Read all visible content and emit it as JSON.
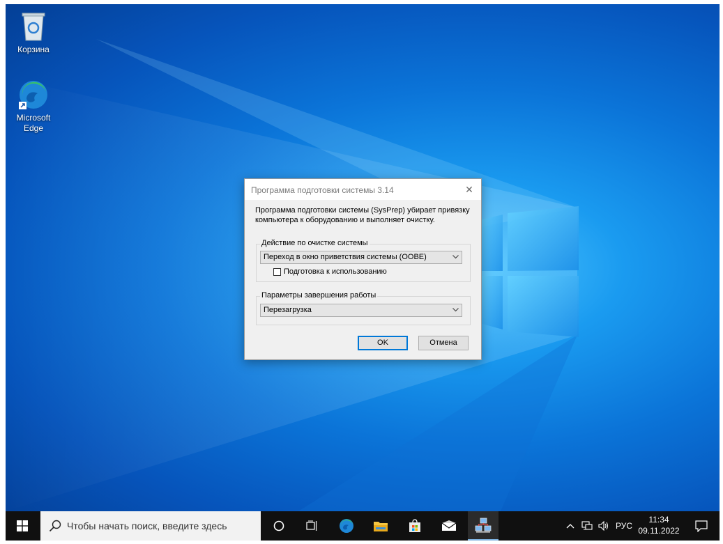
{
  "desktop": {
    "icons": [
      {
        "label": "Корзина",
        "icon": "recycle-bin-icon"
      },
      {
        "label": "Microsoft\nEdge",
        "icon": "edge-icon"
      }
    ]
  },
  "dialog": {
    "title": "Программа подготовки системы 3.14",
    "description": "Программа подготовки системы (SysPrep) убирает привязку компьютера к оборудованию и выполняет очистку.",
    "cleanup_group": {
      "legend": "Действие по очистке системы",
      "selected": "Переход в окно приветствия системы (OOBE)",
      "checkbox_label": "Подготовка к использованию",
      "checkbox_checked": false
    },
    "shutdown_group": {
      "legend": "Параметры завершения работы",
      "selected": "Перезагрузка"
    },
    "ok_label": "OK",
    "cancel_label": "Отмена"
  },
  "taskbar": {
    "search_placeholder": "Чтобы начать поиск, введите здесь",
    "language": "РУС",
    "time": "11:34",
    "date": "09.11.2022",
    "accent": "#0078d7"
  }
}
